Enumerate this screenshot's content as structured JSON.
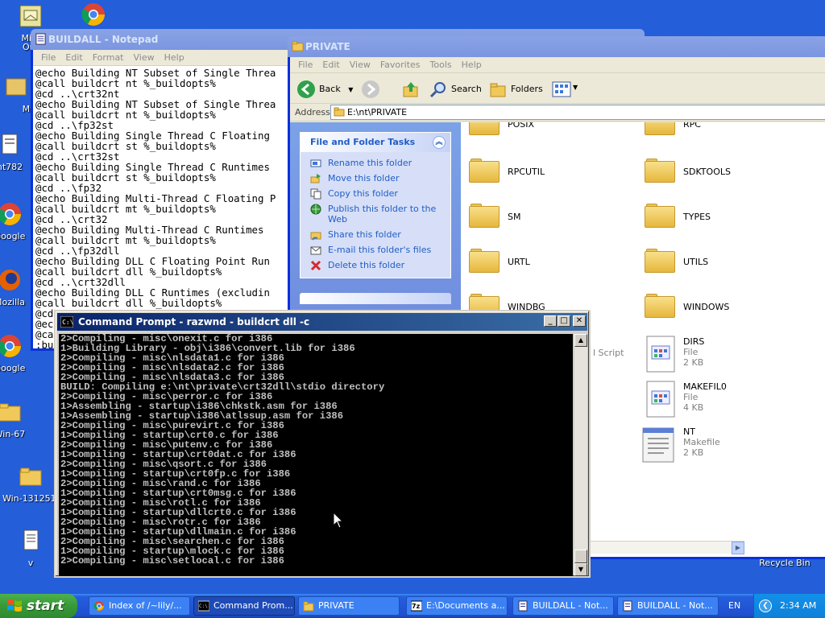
{
  "colors": {
    "desktop": "#245ed9",
    "xp_blue": "#0831d9",
    "task_link": "#215dc6",
    "console_bg": "#000000",
    "console_fg": "#c0c0c0",
    "start_green": "#379937"
  },
  "desktop": {
    "icons": [
      {
        "label": "Micr",
        "label2": "Out",
        "icon": "outlook-icon"
      },
      {
        "label": "MyF",
        "icon": "my-folder-icon"
      },
      {
        "label": "nt782",
        "icon": "file-icon"
      },
      {
        "label": "Google",
        "icon": "chrome-icon"
      },
      {
        "label": "Mozilla",
        "icon": "firefox-icon"
      },
      {
        "label": "Google",
        "icon": "chrome-icon"
      },
      {
        "label": "Win-67",
        "icon": "folder-icon"
      },
      {
        "label": "Win-131251.",
        "icon": "folder-icon"
      },
      {
        "label": "v",
        "icon": "text-file-icon"
      },
      {
        "label": "Recycle Bin",
        "icon": "recycle-bin-icon"
      }
    ]
  },
  "notepad": {
    "title": "BUILDALL - Notepad",
    "menu": [
      "File",
      "Edit",
      "Format",
      "View",
      "Help"
    ],
    "lines": [
      "@echo Building NT Subset of Single Threa",
      "@call buildcrt nt %_buildopts%",
      "@cd ..\\crt32nt",
      "@echo Building NT Subset of Single Threa",
      "@call buildcrt nt %_buildopts%",
      "@cd ..\\fp32st",
      "@echo Building Single Thread C Floating",
      "@call buildcrt st %_buildopts%",
      "@cd ..\\crt32st",
      "@echo Building Single Thread C Runtimes",
      "@call buildcrt st %_buildopts%",
      "@cd ..\\fp32",
      "@echo Building Multi-Thread C Floating P",
      "@call buildcrt mt %_buildopts%",
      "@cd ..\\crt32",
      "@echo Building Multi-Thread C Runtimes",
      "@call buildcrt mt %_buildopts%",
      "@cd ..\\fp32dll",
      "@echo Building DLL C Floating Point Run",
      "@call buildcrt dll %_buildopts%",
      "@cd ..\\crt32dll",
      "@echo Building DLL C Runtimes (excludin",
      "@call buildcrt dll %_buildopts%",
      "@cd",
      "@ec",
      "@ca",
      ":bu",
      "@if",
      "@if",
      "@cd",
      "@ec",
      "@nm",
      "@go",
      ":li"
    ]
  },
  "explorer": {
    "title": "PRIVATE",
    "menu": [
      "File",
      "Edit",
      "View",
      "Favorites",
      "Tools",
      "Help"
    ],
    "toolbar": {
      "back": "Back",
      "search": "Search",
      "folders": "Folders"
    },
    "address_label": "Address",
    "address": "E:\\nt\\PRIVATE",
    "tasks_header": "File and Folder Tasks",
    "tasks": [
      {
        "label": "Rename this folder",
        "icon": "rename-icon"
      },
      {
        "label": "Move this folder",
        "icon": "move-icon"
      },
      {
        "label": "Copy this folder",
        "icon": "copy-icon"
      },
      {
        "label": "Publish this folder to the",
        "label2": "Web",
        "icon": "publish-web-icon"
      },
      {
        "label": "Share this folder",
        "icon": "share-icon"
      },
      {
        "label": "E-mail this folder's files",
        "icon": "email-icon"
      },
      {
        "label": "Delete this folder",
        "icon": "delete-icon"
      }
    ],
    "items": [
      {
        "name": "POSIX"
      },
      {
        "name": "RPC"
      },
      {
        "name": "RPCUTIL"
      },
      {
        "name": "SDKTOOLS"
      },
      {
        "name": "SM"
      },
      {
        "name": "TYPES"
      },
      {
        "name": "URTL"
      },
      {
        "name": "UTILS"
      },
      {
        "name": "WINDBG"
      },
      {
        "name": "WINDOWS"
      },
      {
        "name": "DIRS",
        "type": "File",
        "size": "2 KB"
      },
      {
        "name": "MAKEFIL0",
        "type": "File",
        "size": "4 KB"
      },
      {
        "name": "NT",
        "type": "Makefile",
        "size": "2 KB"
      }
    ],
    "partial_label": "l Script"
  },
  "cmd": {
    "title": "Command Prompt - razwnd - buildcrt dll -c",
    "lines": [
      "2>Compiling - misc\\onexit.c for i386",
      "1>Building Library - obj\\i386\\convert.lib for i386",
      "2>Compiling - misc\\nlsdata1.c for i386",
      "2>Compiling - misc\\nlsdata2.c for i386",
      "2>Compiling - misc\\nlsdata3.c for i386",
      "BUILD: Compiling e:\\nt\\private\\crt32dll\\stdio directory",
      "2>Compiling - misc\\perror.c for i386",
      "1>Assembling - startup\\i386\\chkstk.asm for i386",
      "1>Assembling - startup\\i386\\atlssup.asm for i386",
      "2>Compiling - misc\\purevirt.c for i386",
      "1>Compiling - startup\\crt0.c for i386",
      "2>Compiling - misc\\putenv.c for i386",
      "1>Compiling - startup\\crt0dat.c for i386",
      "2>Compiling - misc\\qsort.c for i386",
      "1>Compiling - startup\\crt0fp.c for i386",
      "2>Compiling - misc\\rand.c for i386",
      "1>Compiling - startup\\crt0msg.c for i386",
      "2>Compiling - misc\\rotl.c for i386",
      "1>Compiling - startup\\dllcrt0.c for i386",
      "2>Compiling - misc\\rotr.c for i386",
      "1>Compiling - startup\\dllmain.c for i386",
      "2>Compiling - misc\\searchen.c for i386",
      "1>Compiling - startup\\mlock.c for i386",
      "2>Compiling - misc\\setlocal.c for i386"
    ]
  },
  "taskbar": {
    "start": "start",
    "tasks": [
      {
        "label": "Index of /~lily/...",
        "icon": "chrome-icon"
      },
      {
        "label": "Command Prom...",
        "icon": "cmd-icon",
        "active": true
      },
      {
        "label": "PRIVATE",
        "icon": "folder-icon"
      },
      {
        "label": "E:\\Documents a...",
        "icon": "7zip-icon"
      },
      {
        "label": "BUILDALL - Not...",
        "icon": "notepad-icon"
      },
      {
        "label": "BUILDALL - Not...",
        "icon": "notepad-icon"
      }
    ],
    "language": "EN",
    "time": "2:34 AM"
  }
}
